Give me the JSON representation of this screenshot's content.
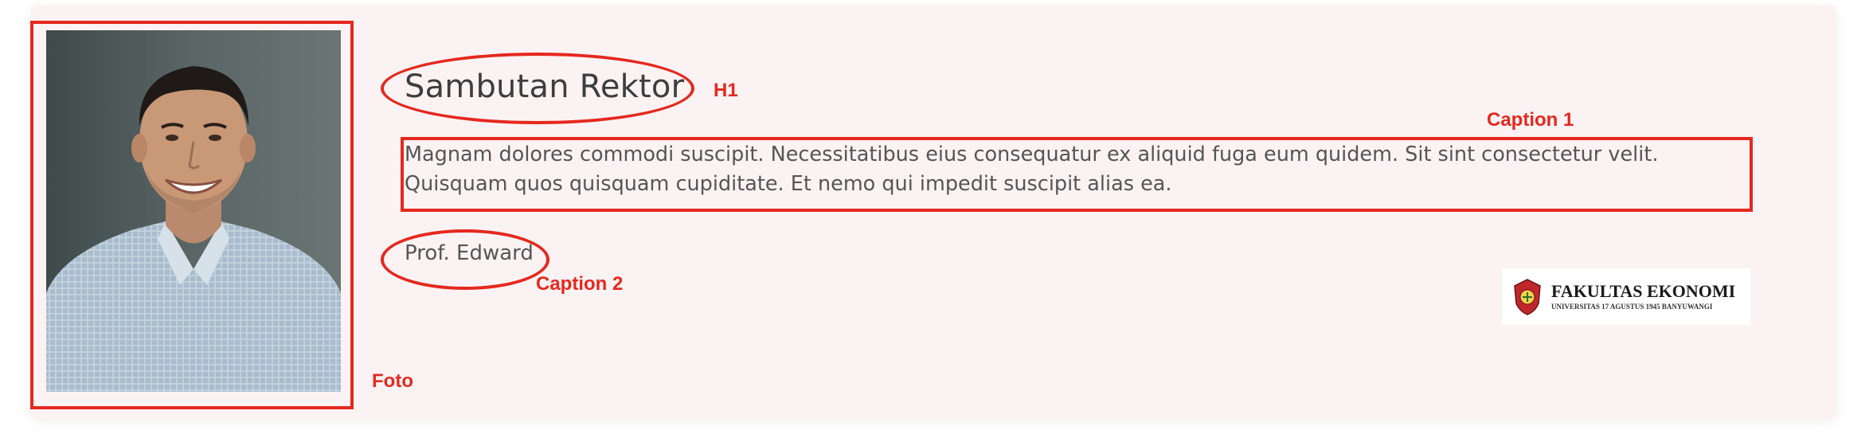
{
  "section": {
    "title": "Sambutan Rektor",
    "body": "Magnam dolores commodi suscipit. Necessitatibus eius consequatur ex aliquid fuga eum quidem. Sit sint consectetur velit. Quisquam quos quisquam cupiditate. Et nemo qui impedit suscipit alias ea.",
    "signatory": "Prof. Edward"
  },
  "logo": {
    "main": "FAKULTAS EKONOMI",
    "sub": "UNIVERSITAS 17 AGUSTUS 1945 BANYUWANGI"
  },
  "annotations": {
    "h1": "H1",
    "caption1": "Caption 1",
    "caption2": "Caption 2",
    "foto": "Foto"
  },
  "colors": {
    "annotation": "#e5281f",
    "card_background": "#fbf3f3",
    "heading_text": "#3d3d3d",
    "body_text": "#555555"
  }
}
